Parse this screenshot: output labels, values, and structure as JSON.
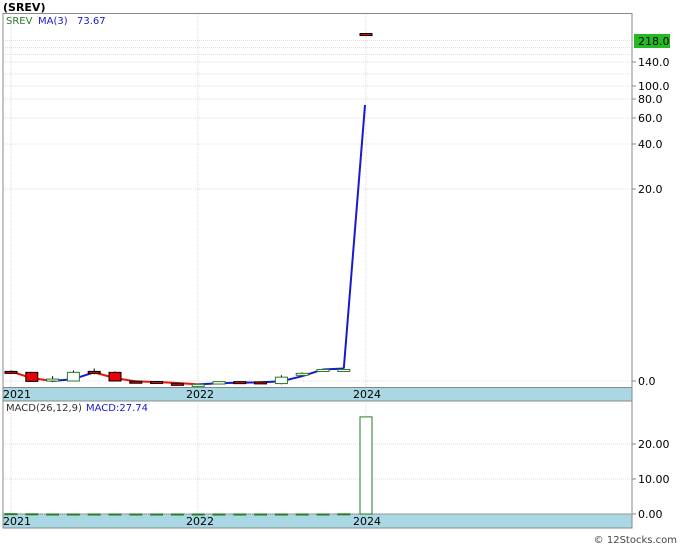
{
  "ticker_title": "(SREV)",
  "copyright": "© 12Stocks.com",
  "colors": {
    "ma_line_up": "#1a1acc",
    "ma_line_down": "#e8150a",
    "candle_down": "#e8000a",
    "candle_up": "#ffffff",
    "candle_border_up": "#2a7a2a",
    "axis_band": "#a9d8e4",
    "price_label_bg": "#22bb22",
    "grid": "#bfbfbf",
    "macd_bar": "#2a7a2a"
  },
  "chart_data": [
    {
      "type": "candlestick",
      "legend": {
        "symbol": "SREV",
        "ma_label": "MA(3)",
        "ma_value": "73.67"
      },
      "y_tick_labels": [
        "0.0",
        "20.0",
        "40.0",
        "60.0",
        "80.0",
        "100.0",
        "140.0"
      ],
      "last_price_label": "218.0",
      "x_tick_labels": [
        "2021",
        "2022",
        "2024"
      ],
      "grid": true,
      "candles": [
        {
          "o": 0.9,
          "h": 1.1,
          "l": 0.8,
          "c": 1.0,
          "dir": "down"
        },
        {
          "o": 0.9,
          "h": 0.95,
          "l": -0.7,
          "c": -0.5,
          "dir": "down"
        },
        {
          "o": -0.1,
          "h": 0.5,
          "l": -1.3,
          "c": 0.2,
          "dir": "up"
        },
        {
          "o": 0.0,
          "h": 1.1,
          "l": -0.1,
          "c": 0.9,
          "dir": "up"
        },
        {
          "o": 1.0,
          "h": 1.3,
          "l": 0.7,
          "c": 0.9,
          "dir": "down"
        },
        {
          "o": 0.9,
          "h": 1.0,
          "l": -0.1,
          "c": 0.0,
          "dir": "down"
        },
        {
          "o": -0.3,
          "h": -0.2,
          "l": -0.6,
          "c": -0.5,
          "dir": "down"
        },
        {
          "o": -0.6,
          "h": -0.6,
          "l": -2.6,
          "c": -2.6,
          "dir": "down"
        },
        {
          "o": -2.9,
          "h": -2.9,
          "l": -4.1,
          "c": -4.0,
          "dir": "down"
        },
        {
          "o": -4.2,
          "h": -3.9,
          "l": -4.7,
          "c": -4.5,
          "dir": "up"
        },
        {
          "o": -3.8,
          "h": -0.6,
          "l": -4.2,
          "c": -0.8,
          "dir": "up"
        },
        {
          "o": -0.8,
          "h": -0.6,
          "l": -1.5,
          "c": -1.1,
          "dir": "down"
        },
        {
          "o": -1.1,
          "h": -0.8,
          "l": -3.0,
          "c": -2.9,
          "dir": "down"
        },
        {
          "o": -3.2,
          "h": 0.6,
          "l": -4.2,
          "c": 0.4,
          "dir": "up"
        },
        {
          "o": 0.6,
          "h": 0.9,
          "l": 0.5,
          "c": 0.8,
          "dir": "up"
        },
        {
          "o": 1.2,
          "h": 1.2,
          "l": 1.0,
          "c": 1.2,
          "dir": "up"
        },
        {
          "o": 1.2,
          "h": 1.2,
          "l": 1.1,
          "c": 1.2,
          "dir": "up"
        },
        {
          "o": 218.5,
          "h": 219.5,
          "l": 216.5,
          "c": 217.0,
          "dir": "down"
        }
      ],
      "ma_series": [
        1.0,
        0.3,
        0.0,
        0.2,
        0.9,
        0.3,
        -0.5,
        -1.3,
        -2.5,
        -4.2,
        -2.8,
        -2.1,
        -1.7,
        -0.3,
        0.5,
        1.2,
        1.3,
        73.67
      ]
    },
    {
      "type": "bar",
      "legend": {
        "label": "MACD(26,12,9)",
        "macd_label": "MACD:27.74"
      },
      "y_tick_labels": [
        "0.00",
        "10.00",
        "20.00"
      ],
      "x_tick_labels": [
        "2021",
        "2022",
        "2024"
      ],
      "ylim": [
        0,
        28
      ],
      "values": [
        0.1,
        0.05,
        0.0,
        0.0,
        0.0,
        0.0,
        0.0,
        0.0,
        0.0,
        0.0,
        0.0,
        0.0,
        0.0,
        0.0,
        0.0,
        0.0,
        0.05,
        27.74
      ]
    }
  ]
}
